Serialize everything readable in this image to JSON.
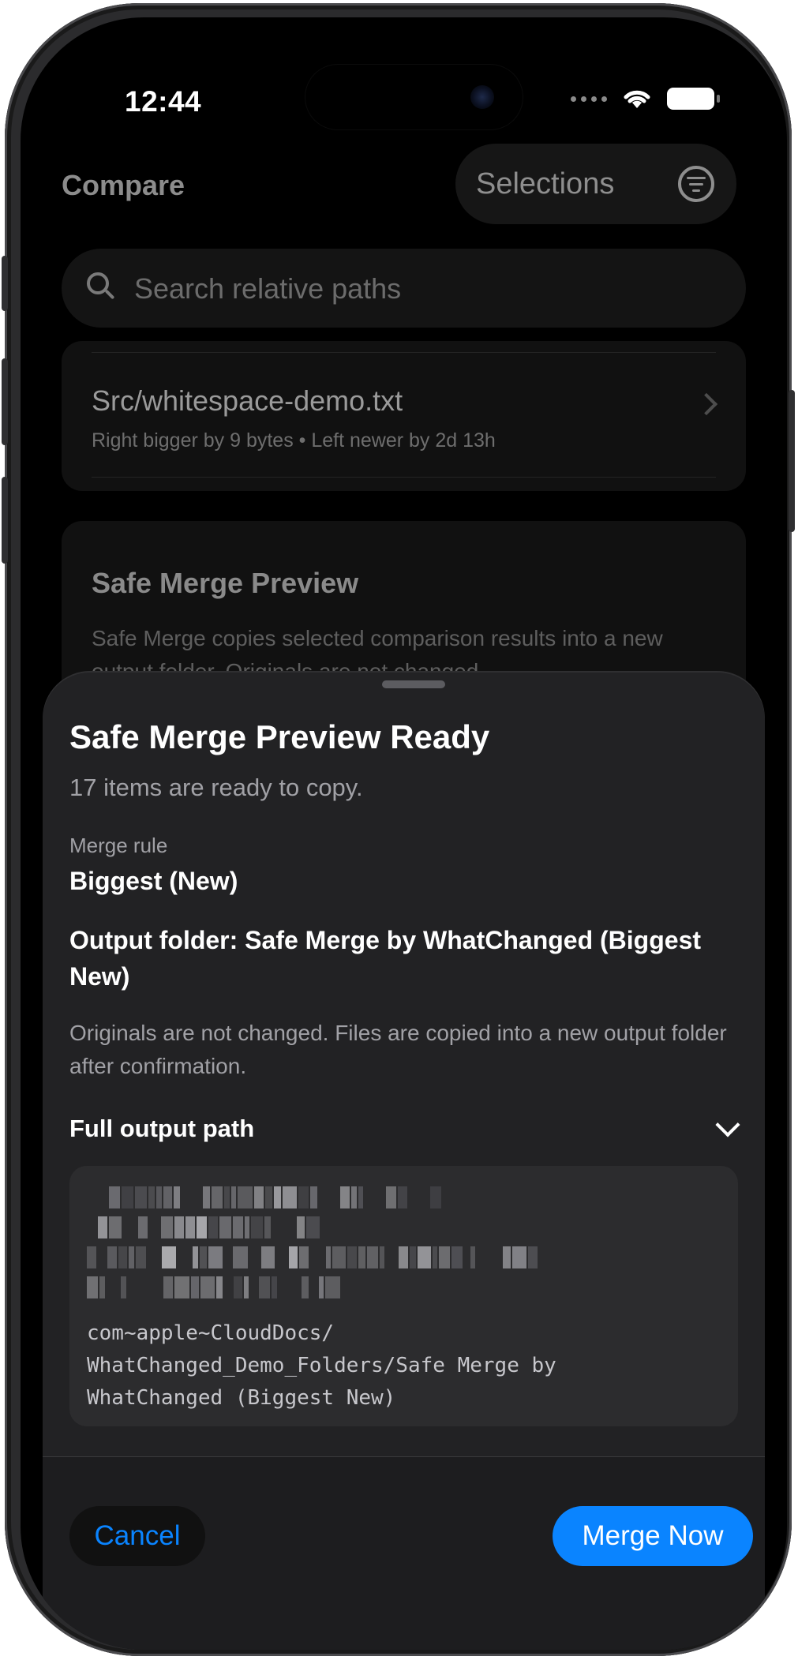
{
  "status_bar": {
    "time": "12:44"
  },
  "header": {
    "title": "Compare",
    "selections_label": "Selections"
  },
  "search": {
    "placeholder": "Search relative paths"
  },
  "file_row": {
    "name": "Src/whitespace-demo.txt",
    "meta": "Right bigger by 9 bytes • Left newer by 2d 13h"
  },
  "preview_card": {
    "title": "Safe Merge Preview",
    "body": "Safe Merge copies selected comparison results into a new output folder. Originals are not changed."
  },
  "sheet": {
    "title": "Safe Merge Preview Ready",
    "subtitle": "17 items are ready to copy.",
    "rule_label": "Merge rule",
    "rule_value": "Biggest (New)",
    "output_folder": "Output folder: Safe Merge by WhatChanged (Biggest New)",
    "originals_note": "Originals are not changed. Files are copied into a new output folder after confirmation.",
    "path_header": "Full output path",
    "path_text": "com~apple~CloudDocs/\nWhatChanged_Demo_Folders/Safe Merge by\nWhatChanged (Biggest New)",
    "cancel_label": "Cancel",
    "merge_label": "Merge Now"
  },
  "colors": {
    "accent": "#0a84ff",
    "sheet_bg": "#222224",
    "path_box_bg": "#2c2c2e"
  },
  "icons": [
    "search-icon",
    "filter-icon",
    "chevron-right-icon",
    "chevron-down-icon",
    "wifi-icon",
    "battery-icon"
  ]
}
